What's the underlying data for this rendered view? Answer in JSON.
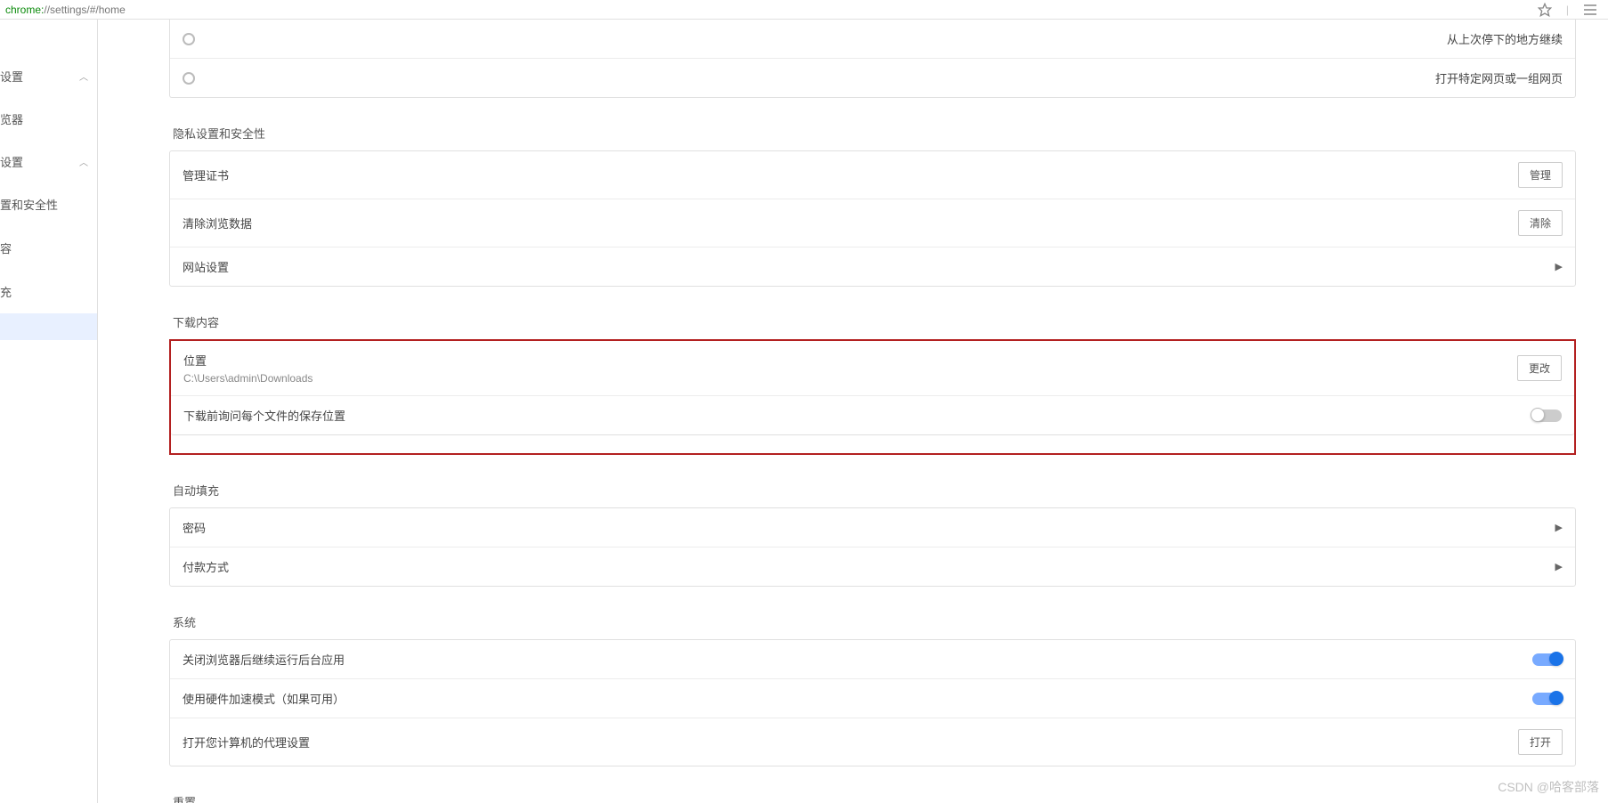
{
  "address": {
    "scheme": "chrome:",
    "rest": "//settings/#/home"
  },
  "sidebar": {
    "group1": {
      "head": "设置"
    },
    "group2": {
      "head": "设置"
    },
    "items": {
      "browser": "览器",
      "privacy": "置和安全性",
      "content": "容",
      "autofill": "充"
    }
  },
  "startup": {
    "opt_continue": "从上次停下的地方继续",
    "opt_pages": "打开特定网页或一组网页"
  },
  "privacy": {
    "title": "隐私设置和安全性",
    "certs": "管理证书",
    "certs_btn": "管理",
    "clear": "清除浏览数据",
    "clear_btn": "清除",
    "site": "网站设置"
  },
  "downloads": {
    "title": "下载内容",
    "location_label": "位置",
    "location_value": "C:\\Users\\admin\\Downloads",
    "change_btn": "更改",
    "ask_label": "下载前询问每个文件的保存位置"
  },
  "autofill": {
    "title": "自动填充",
    "password": "密码",
    "payment": "付款方式"
  },
  "system": {
    "title": "系统",
    "bg_apps": "关闭浏览器后继续运行后台应用",
    "hw_accel": "使用硬件加速模式（如果可用）",
    "proxy": "打开您计算机的代理设置",
    "open_btn": "打开"
  },
  "reset": {
    "title": "重置"
  },
  "watermark": "CSDN @哈客部落"
}
